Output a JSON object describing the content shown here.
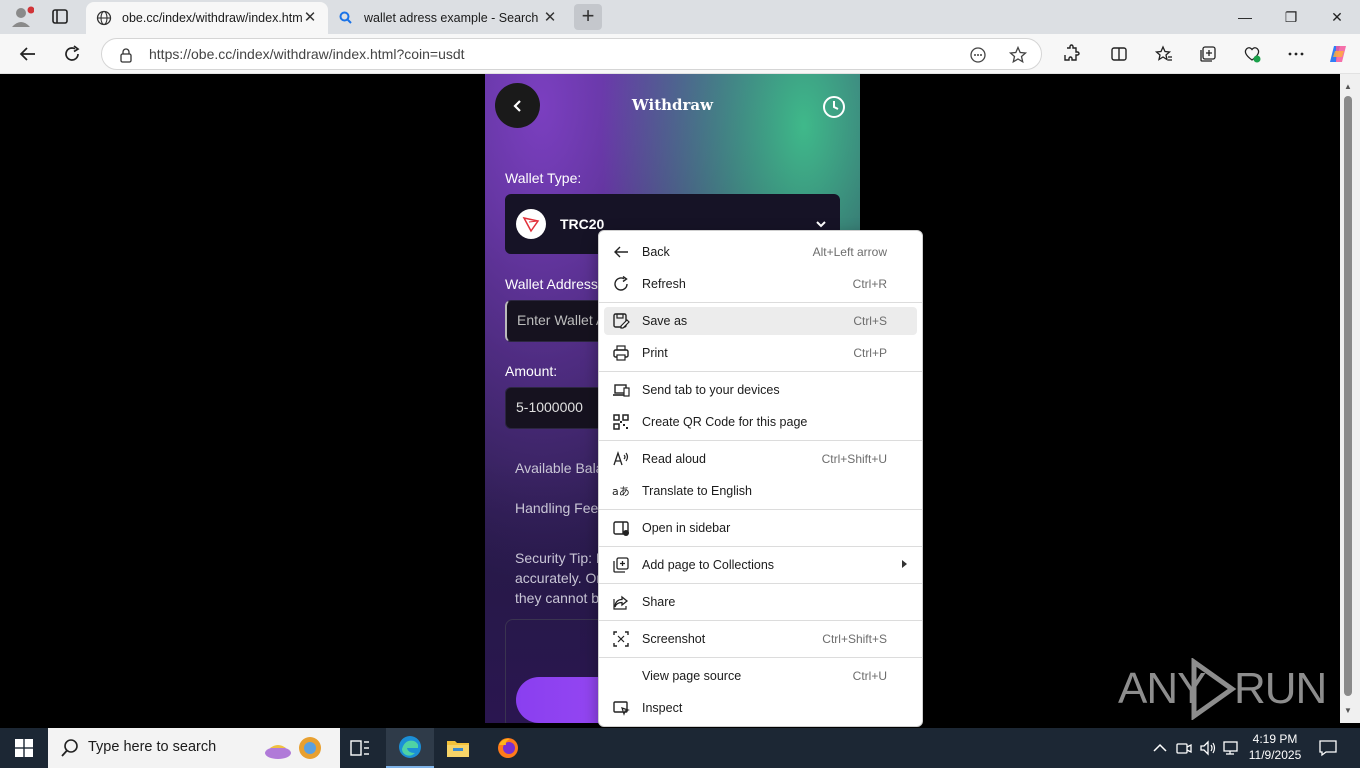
{
  "browser": {
    "tabs": [
      {
        "title": "obe.cc/index/withdraw/index.htm",
        "active": true
      },
      {
        "title": "wallet adress example - Search",
        "active": false
      }
    ],
    "address": "https://obe.cc/index/withdraw/index.html?coin=usdt"
  },
  "page": {
    "title": "Withdraw",
    "wallet_type_label": "Wallet Type:",
    "wallet_type_value": "TRC20",
    "wallet_address_label": "Wallet Address",
    "wallet_address_placeholder": "Enter Wallet A",
    "amount_label": "Amount:",
    "amount_placeholder": "5-1000000",
    "available_balance": "Available Bala",
    "handling_fee": "Handling Fee",
    "security_tip_lines": [
      "Security Tip: F",
      "accurately. Or",
      "they cannot b"
    ]
  },
  "context_menu": {
    "items": [
      {
        "label": "Back",
        "shortcut": "Alt+Left arrow",
        "icon": "back-arrow-icon"
      },
      {
        "label": "Refresh",
        "shortcut": "Ctrl+R",
        "icon": "refresh-icon"
      },
      {
        "label": "Save as",
        "shortcut": "Ctrl+S",
        "icon": "save-as-icon"
      },
      {
        "label": "Print",
        "shortcut": "Ctrl+P",
        "icon": "print-icon"
      },
      {
        "label": "Send tab to your devices",
        "shortcut": "",
        "icon": "devices-icon"
      },
      {
        "label": "Create QR Code for this page",
        "shortcut": "",
        "icon": "qr-code-icon"
      },
      {
        "label": "Read aloud",
        "shortcut": "Ctrl+Shift+U",
        "icon": "read-aloud-icon"
      },
      {
        "label": "Translate to English",
        "shortcut": "",
        "icon": "translate-icon"
      },
      {
        "label": "Open in sidebar",
        "shortcut": "",
        "icon": "sidebar-icon"
      },
      {
        "label": "Add page to Collections",
        "shortcut": "",
        "icon": "collections-icon"
      },
      {
        "label": "Share",
        "shortcut": "",
        "icon": "share-icon"
      },
      {
        "label": "Screenshot",
        "shortcut": "Ctrl+Shift+S",
        "icon": "screenshot-icon"
      },
      {
        "label": "View page source",
        "shortcut": "Ctrl+U",
        "icon": ""
      },
      {
        "label": "Inspect",
        "shortcut": "",
        "icon": "inspect-icon"
      }
    ],
    "highlighted": "Save as"
  },
  "watermark": {
    "left": "ANY",
    "right": "RUN"
  },
  "taskbar": {
    "search_placeholder": "Type here to search",
    "time": "4:19 PM",
    "date": "11/9/2025"
  }
}
